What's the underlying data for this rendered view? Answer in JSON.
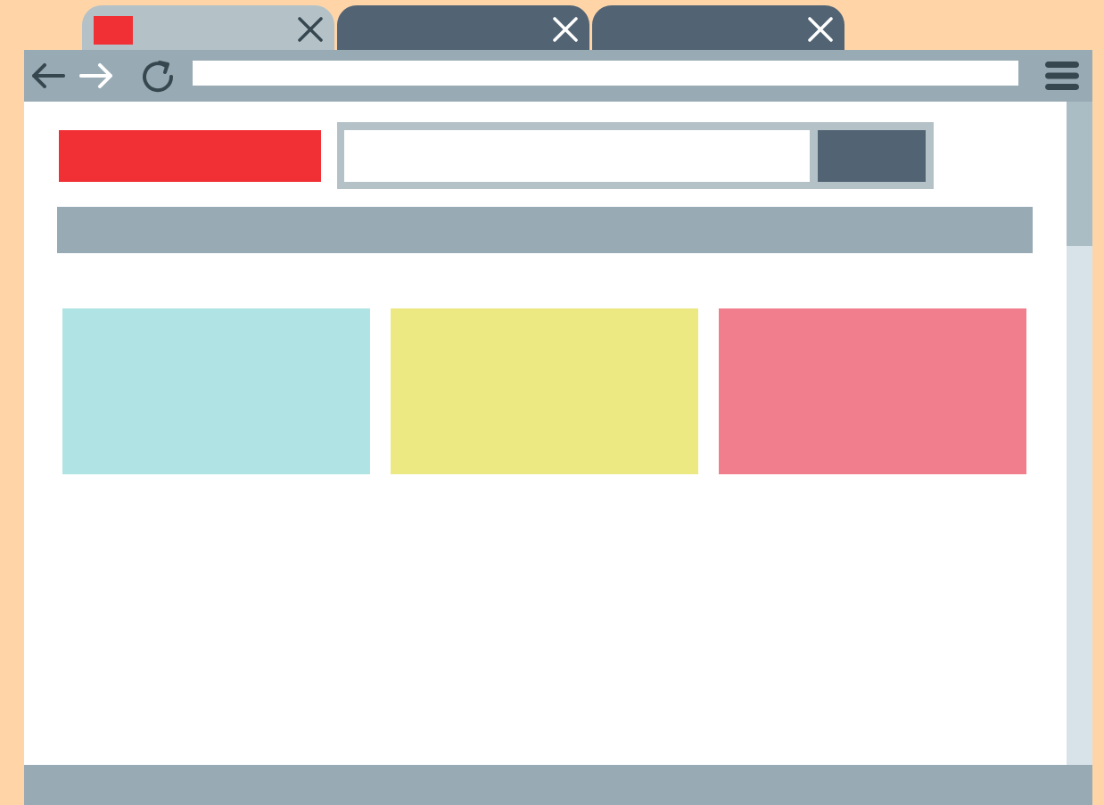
{
  "colors": {
    "page_background": "#ffd5a8",
    "tab_active": "#b4c2c8",
    "tab_inactive": "#526474",
    "toolbar": "#98aab4",
    "icon_dark": "#37474f",
    "icon_light": "#ffffff",
    "scroll_track": "#d7e3e8",
    "scroll_thumb": "#aabdc5",
    "status_bar": "#98aab4",
    "logo": "#f03034",
    "search_frame": "#b4c2c8",
    "search_button": "#526474",
    "nav_bar": "#98aab4",
    "card_1": "#b0e4e4",
    "card_2": "#ece882",
    "card_3": "#f07e8c"
  },
  "tabs": [
    {
      "title": "",
      "active": true,
      "favicon_color": "#f03034",
      "close_icon": "close-icon"
    },
    {
      "title": "",
      "active": false,
      "close_icon": "close-icon"
    },
    {
      "title": "",
      "active": false,
      "close_icon": "close-icon"
    }
  ],
  "toolbar": {
    "back_icon": "arrow-left-icon",
    "forward_icon": "arrow-right-icon",
    "reload_icon": "reload-icon",
    "address": {
      "value": "",
      "placeholder": ""
    },
    "menu_icon": "hamburger-menu-icon"
  },
  "page": {
    "search": {
      "value": "",
      "placeholder": "",
      "button_label": ""
    },
    "cards": [
      "",
      "",
      ""
    ]
  }
}
